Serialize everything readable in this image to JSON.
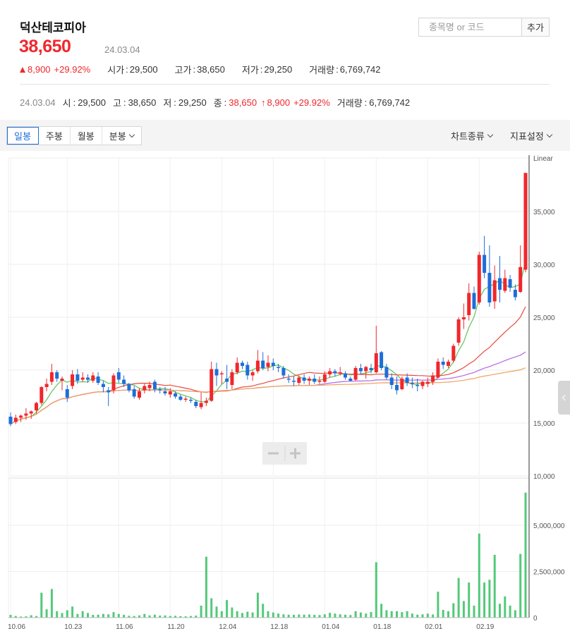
{
  "header": {
    "stock_name": "덕산테코피아",
    "price": "38,650",
    "date": "24.03.04",
    "search_placeholder": "종목명 or 코드",
    "add_label": "추가"
  },
  "summary": {
    "change": "8,900",
    "change_pct": "+29.92%",
    "open_label": "시가",
    "open": "29,500",
    "high_label": "고가",
    "high": "38,650",
    "low_label": "저가",
    "low": "29,250",
    "volume_label": "거래량",
    "volume": "6,769,742"
  },
  "detail": {
    "date": "24.03.04",
    "open_label": "시",
    "open": "29,500",
    "high_label": "고",
    "high": "38,650",
    "low_label": "저",
    "low": "29,250",
    "close_label": "종",
    "close": "38,650",
    "arrow": "↑",
    "change": "8,900",
    "change_pct": "+29.92%",
    "volume_label": "거래량",
    "volume": "6,769,742"
  },
  "toolbar": {
    "tabs": [
      "일봉",
      "주봉",
      "월봉",
      "분봉"
    ],
    "active_tab": "일봉",
    "chart_type_label": "차트종류",
    "indicator_label": "지표설정"
  },
  "colors": {
    "up": "#f0272c",
    "down": "#1e6ed8",
    "volume": "#53c97a",
    "ma5": "#5ec45a",
    "ma20": "#e84a3c",
    "ma60": "#b267e6",
    "ma120": "#f0a25a"
  },
  "chart_data": {
    "type": "candlestick",
    "scale_label": "Linear",
    "price_ticks": [
      "35,000",
      "30,000",
      "25,000",
      "20,000",
      "15,000",
      "10,000"
    ],
    "price_tick_values": [
      35000,
      30000,
      25000,
      20000,
      15000,
      10000
    ],
    "volume_ticks": [
      "5,000,000",
      "2,500,000",
      "0"
    ],
    "volume_tick_values": [
      5000000,
      2500000,
      0
    ],
    "x_labels": [
      "10.06",
      "10.23",
      "11.06",
      "11.20",
      "12.04",
      "12.18",
      "01.04",
      "01.18",
      "02.01",
      "02.19"
    ],
    "x_label_indices": [
      0,
      11,
      21,
      31,
      41,
      51,
      61,
      71,
      81,
      91
    ],
    "grid": true,
    "candles": [
      [
        15600,
        16000,
        14700,
        14900
      ],
      [
        15100,
        15800,
        14900,
        15500
      ],
      [
        15500,
        15800,
        15100,
        15700
      ],
      [
        15700,
        16400,
        15300,
        15900
      ],
      [
        15900,
        16200,
        15400,
        16100
      ],
      [
        16200,
        17000,
        15900,
        16900
      ],
      [
        16900,
        18500,
        16700,
        18400
      ],
      [
        18400,
        19200,
        18000,
        18700
      ],
      [
        18900,
        20600,
        18600,
        19800
      ],
      [
        19800,
        20000,
        18900,
        19200
      ],
      [
        19000,
        19400,
        18100,
        19200
      ],
      [
        18200,
        18600,
        17000,
        17400
      ],
      [
        18500,
        20000,
        18200,
        19600
      ],
      [
        19600,
        20100,
        18700,
        19000
      ],
      [
        19100,
        19800,
        18900,
        19300
      ],
      [
        19300,
        19600,
        18800,
        19100
      ],
      [
        19000,
        19800,
        18800,
        19500
      ],
      [
        19400,
        19800,
        18600,
        18800
      ],
      [
        18700,
        19000,
        17900,
        18400
      ],
      [
        18100,
        18400,
        16600,
        17900
      ],
      [
        18100,
        19700,
        17800,
        19500
      ],
      [
        19800,
        20200,
        18800,
        19100
      ],
      [
        19100,
        19500,
        18400,
        18700
      ],
      [
        18700,
        18800,
        17900,
        18100
      ],
      [
        18200,
        18500,
        17300,
        17500
      ],
      [
        17400,
        18300,
        17200,
        18000
      ],
      [
        18100,
        18700,
        17800,
        18500
      ],
      [
        18300,
        18900,
        18000,
        18600
      ],
      [
        18900,
        19100,
        17900,
        18200
      ],
      [
        18200,
        18400,
        17800,
        18100
      ],
      [
        18000,
        18400,
        17600,
        17800
      ],
      [
        17700,
        18300,
        17400,
        18000
      ],
      [
        17800,
        18000,
        17300,
        17500
      ],
      [
        17500,
        17700,
        17100,
        17200
      ],
      [
        17200,
        17500,
        17000,
        17300
      ],
      [
        17200,
        17400,
        16900,
        17100
      ],
      [
        17000,
        17200,
        16400,
        16600
      ],
      [
        16500,
        17900,
        16300,
        16900
      ],
      [
        16900,
        17400,
        16600,
        17100
      ],
      [
        17100,
        20800,
        17000,
        20100
      ],
      [
        20100,
        20700,
        18500,
        19500
      ],
      [
        19600,
        19900,
        18700,
        19700
      ],
      [
        19200,
        20500,
        18200,
        18900
      ],
      [
        18600,
        20100,
        18200,
        19800
      ],
      [
        19800,
        21200,
        19600,
        20700
      ],
      [
        20700,
        20900,
        20100,
        20400
      ],
      [
        20500,
        20800,
        19100,
        19500
      ],
      [
        19500,
        20000,
        19000,
        19800
      ],
      [
        19900,
        21900,
        19700,
        20900
      ],
      [
        20900,
        21700,
        20000,
        20200
      ],
      [
        20300,
        21400,
        19900,
        20700
      ],
      [
        20700,
        21100,
        20000,
        20400
      ],
      [
        20300,
        20600,
        19800,
        20200
      ],
      [
        20200,
        20400,
        19200,
        19500
      ],
      [
        19200,
        19600,
        18800,
        19100
      ],
      [
        19000,
        19400,
        18500,
        18900
      ],
      [
        18800,
        19500,
        18600,
        19300
      ],
      [
        19300,
        19600,
        18700,
        19000
      ],
      [
        19000,
        19400,
        18600,
        19200
      ],
      [
        19200,
        19600,
        18700,
        18900
      ],
      [
        18900,
        19400,
        18700,
        19000
      ],
      [
        18900,
        19900,
        18800,
        19600
      ],
      [
        19600,
        20200,
        19300,
        19900
      ],
      [
        19900,
        20100,
        19400,
        19700
      ],
      [
        19700,
        20300,
        19500,
        19800
      ],
      [
        19700,
        19900,
        19100,
        19300
      ],
      [
        19200,
        19400,
        18900,
        19000
      ],
      [
        19100,
        20400,
        19000,
        20200
      ],
      [
        20200,
        20600,
        19600,
        19900
      ],
      [
        19900,
        20400,
        19200,
        20300
      ],
      [
        20200,
        20600,
        19700,
        20000
      ],
      [
        19800,
        24200,
        19700,
        21600
      ],
      [
        21700,
        21800,
        20000,
        20200
      ],
      [
        20300,
        20600,
        19100,
        19300
      ],
      [
        19300,
        19700,
        18200,
        18600
      ],
      [
        18600,
        19400,
        17700,
        18100
      ],
      [
        18200,
        19400,
        18100,
        19200
      ],
      [
        19300,
        19700,
        18500,
        18800
      ],
      [
        18800,
        19300,
        18300,
        18700
      ],
      [
        18600,
        19200,
        18000,
        18500
      ],
      [
        18500,
        19000,
        18200,
        18900
      ],
      [
        18700,
        19300,
        18400,
        18900
      ],
      [
        18900,
        19800,
        18600,
        19500
      ],
      [
        19300,
        21100,
        19200,
        20800
      ],
      [
        20800,
        21200,
        20100,
        20500
      ],
      [
        20400,
        21000,
        20200,
        20800
      ],
      [
        20900,
        22500,
        20700,
        22300
      ],
      [
        22600,
        25000,
        22300,
        24800
      ],
      [
        24800,
        26300,
        23900,
        25000
      ],
      [
        25200,
        28200,
        24700,
        27300
      ],
      [
        27300,
        27900,
        25700,
        25800
      ],
      [
        26400,
        31200,
        26200,
        30900
      ],
      [
        30900,
        32700,
        28700,
        29200
      ],
      [
        29200,
        31800,
        26000,
        26400
      ],
      [
        26500,
        29900,
        25800,
        28500
      ],
      [
        28700,
        30800,
        26400,
        27600
      ],
      [
        27500,
        29500,
        27300,
        28700
      ],
      [
        28600,
        29000,
        27400,
        27800
      ],
      [
        27600,
        28100,
        26600,
        26900
      ],
      [
        27400,
        31800,
        27300,
        29750
      ],
      [
        29500,
        38650,
        29250,
        38650
      ]
    ],
    "volumes": [
      150000,
      90000,
      60000,
      70000,
      130000,
      90000,
      1350000,
      450000,
      1550000,
      350000,
      250000,
      400000,
      600000,
      200000,
      350000,
      250000,
      150000,
      160000,
      200000,
      180000,
      300000,
      200000,
      150000,
      100000,
      90000,
      120000,
      200000,
      120000,
      160000,
      110000,
      120000,
      90000,
      100000,
      80000,
      70000,
      90000,
      110000,
      650000,
      3300000,
      1050000,
      600000,
      350000,
      950000,
      550000,
      350000,
      250000,
      320000,
      280000,
      1350000,
      750000,
      350000,
      280000,
      220000,
      180000,
      160000,
      150000,
      170000,
      160000,
      170000,
      150000,
      140000,
      180000,
      260000,
      220000,
      180000,
      160000,
      140000,
      350000,
      280000,
      220000,
      300000,
      3000000,
      750000,
      400000,
      350000,
      350000,
      300000,
      350000,
      220000,
      160000,
      180000,
      220000,
      170000,
      1400000,
      420000,
      350000,
      780000,
      2150000,
      900000,
      1900000,
      650000,
      4550000,
      1900000,
      2050000,
      3400000,
      750000,
      1150000,
      650000,
      400000,
      3450000,
      6769742
    ],
    "moving_averages": [
      {
        "period": 5,
        "color": "#5ec45a"
      },
      {
        "period": 20,
        "color": "#e84a3c"
      },
      {
        "period": 60,
        "color": "#b267e6"
      },
      {
        "period": 120,
        "color": "#f0a25a"
      }
    ]
  }
}
